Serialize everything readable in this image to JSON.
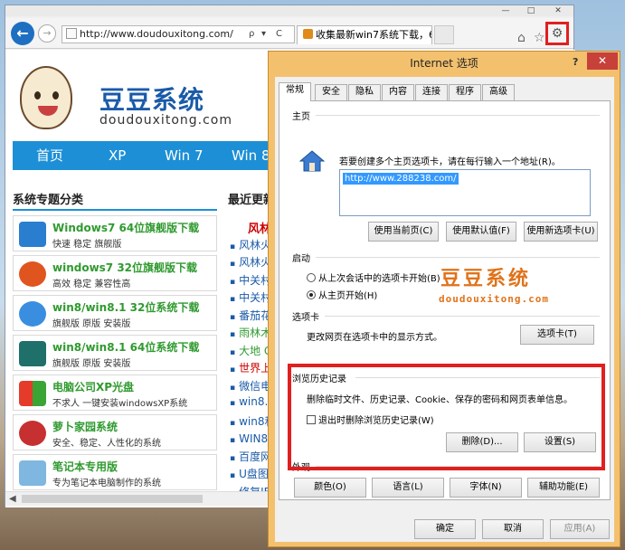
{
  "browser": {
    "window_controls": {
      "minimize": "—",
      "maximize": "□",
      "close": "✕"
    },
    "address": "http://www.doudouxitong.com/",
    "address_controls": {
      "search": "ρ",
      "dropdown": "▾",
      "refresh": "C"
    },
    "tab_title": "收集最新win7系统下载，6...",
    "icons": [
      "back-arrow-icon",
      "forward-arrow-icon",
      "home-icon",
      "star-icon",
      "gear-icon"
    ],
    "highlight_color": "#e02020"
  },
  "site": {
    "logo_text": "豆豆系统",
    "logo_sub": "doudouxitong.com",
    "nav": [
      "首页",
      "XP",
      "Win 7",
      "Win 8"
    ],
    "section_title": "系统专题分类",
    "news_title": "最近更新",
    "list": [
      {
        "title": "Windows7 64位旗舰版下载",
        "sub": "快速 稳定 旗舰版",
        "icon": "windows7-logo-icon"
      },
      {
        "title": "windows7 32位旗舰版下载",
        "sub": "高效 稳定 兼容性高",
        "icon": "firefox-logo-icon"
      },
      {
        "title": "win8/win8.1 32位系统下载",
        "sub": "旗舰版 原版 安装版",
        "icon": "windows-orb-icon"
      },
      {
        "title": "win8/win8.1 64位系统下载",
        "sub": "旗舰版 原版 安装版",
        "icon": "green-scatter-icon"
      },
      {
        "title": "电脑公司XP光盘",
        "sub": "不求人 一键安装windowsXP系统",
        "icon": "windows-xp-flag-icon"
      },
      {
        "title": "萝卜家园系统",
        "sub": "安全、稳定、人性化的系统",
        "icon": "radish-icon"
      },
      {
        "title": "笔记本专用版",
        "sub": "专为笔记本电脑制作的系统",
        "icon": "laptop-icon"
      }
    ],
    "news": [
      {
        "text": "风林",
        "color": "#cc0000",
        "bullet": false
      },
      {
        "text": "风林火",
        "color": "#1a5aa8",
        "bullet": true
      },
      {
        "text": "风林火",
        "color": "#1a5aa8",
        "bullet": true
      },
      {
        "text": "中关村",
        "color": "#1a5aa8",
        "bullet": true
      },
      {
        "text": "中关村",
        "color": "#1a5aa8",
        "bullet": true
      },
      {
        "text": "番茄花",
        "color": "#1a5aa8",
        "bullet": true
      },
      {
        "text": "雨林木",
        "color": "#2f9a2f",
        "bullet": true
      },
      {
        "text": "大地 G",
        "color": "#2f9a2f",
        "bullet": true
      },
      {
        "text": "世界上",
        "color": "#cc0000",
        "bullet": true
      },
      {
        "text": "微信电",
        "color": "#1a5aa8",
        "bullet": true
      },
      {
        "text": "win8.1",
        "color": "#1a5aa8",
        "bullet": true
      },
      {
        "text": "win8和",
        "color": "#1a5aa8",
        "bullet": true
      },
      {
        "text": "WIN8系",
        "color": "#1a5aa8",
        "bullet": true
      },
      {
        "text": "百度网",
        "color": "#1a5aa8",
        "bullet": true
      },
      {
        "text": "U盘图",
        "color": "#1a5aa8",
        "bullet": true
      },
      {
        "text": "修复IE",
        "color": "#1a5aa8",
        "bullet": true
      }
    ]
  },
  "dialog": {
    "title": "Internet 选项",
    "help": "?",
    "close": "✕",
    "tabs": [
      "常规",
      "安全",
      "隐私",
      "内容",
      "连接",
      "程序",
      "高级"
    ],
    "home": {
      "label": "主页",
      "desc": "若要创建多个主页选项卡，请在每行输入一个地址(R)。",
      "url": "http://www.288238.com/",
      "buttons": [
        "使用当前页(C)",
        "使用默认值(F)",
        "使用新选项卡(U)"
      ]
    },
    "startup": {
      "label": "启动",
      "options": [
        "从上次会话中的选项卡开始(B)",
        "从主页开始(H)"
      ],
      "selected": 1
    },
    "watermark": {
      "title": "豆豆系统",
      "sub": "doudouxitong.com"
    },
    "tabs_group": {
      "label": "选项卡",
      "desc": "更改网页在选项卡中的显示方式。",
      "button": "选项卡(T)"
    },
    "history": {
      "label": "浏览历史记录",
      "desc": "删除临时文件、历史记录、Cookie、保存的密码和网页表单信息。",
      "checkbox": "退出时删除浏览历史记录(W)",
      "checked": false,
      "delete_button": "删除(D)...",
      "settings_button": "设置(S)"
    },
    "appearance": {
      "label": "外观",
      "buttons": [
        "颜色(O)",
        "语言(L)",
        "字体(N)",
        "辅助功能(E)"
      ]
    },
    "footer": {
      "ok": "确定",
      "cancel": "取消",
      "apply": "应用(A)"
    }
  }
}
